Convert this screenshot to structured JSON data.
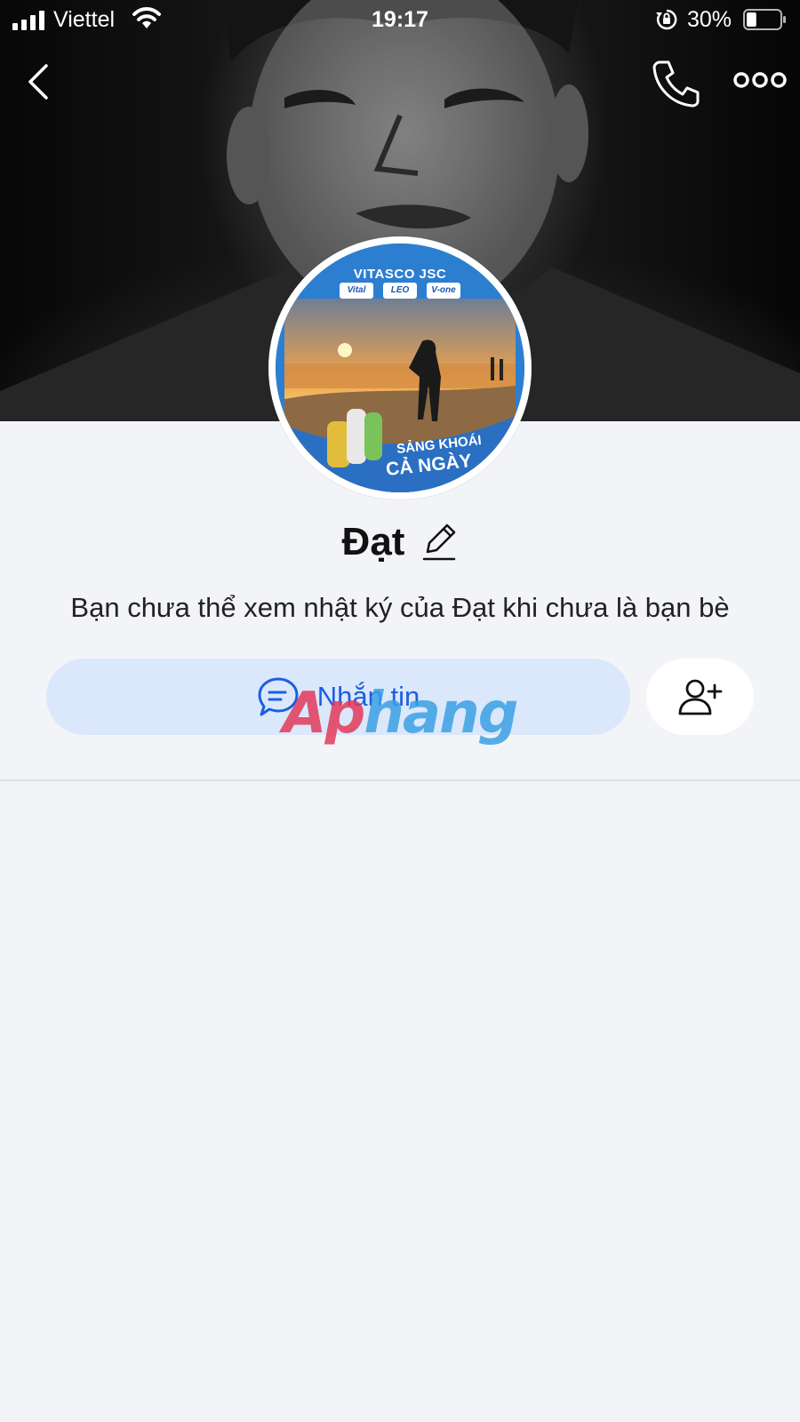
{
  "status_bar": {
    "carrier": "Viettel",
    "time": "19:17",
    "battery_percent": "30%",
    "battery_level": 0.3
  },
  "header": {
    "back_icon": "chevron-left-icon",
    "call_icon": "phone-icon",
    "more_icon": "more-options-icon"
  },
  "avatar": {
    "brand": "VITASCO JSC",
    "chips": [
      "Vital",
      "LEO",
      "V-one"
    ],
    "slogan_line1": "SẢNG KHOÁI",
    "slogan_line2": "CẢ NGÀY"
  },
  "profile": {
    "name": "Đạt",
    "notice": "Bạn chưa thể xem nhật ký của Đạt khi chưa là bạn bè"
  },
  "actions": {
    "message_label": "Nhắn tin",
    "message_icon": "chat-bubble-icon",
    "add_friend_icon": "add-friend-icon"
  },
  "colors": {
    "accent": "#1c5fe0",
    "message_button_bg": "#dbe7fb",
    "page_bg": "#f3f4f7"
  },
  "watermark": {
    "part1": "Ap",
    "part2": "hang"
  }
}
